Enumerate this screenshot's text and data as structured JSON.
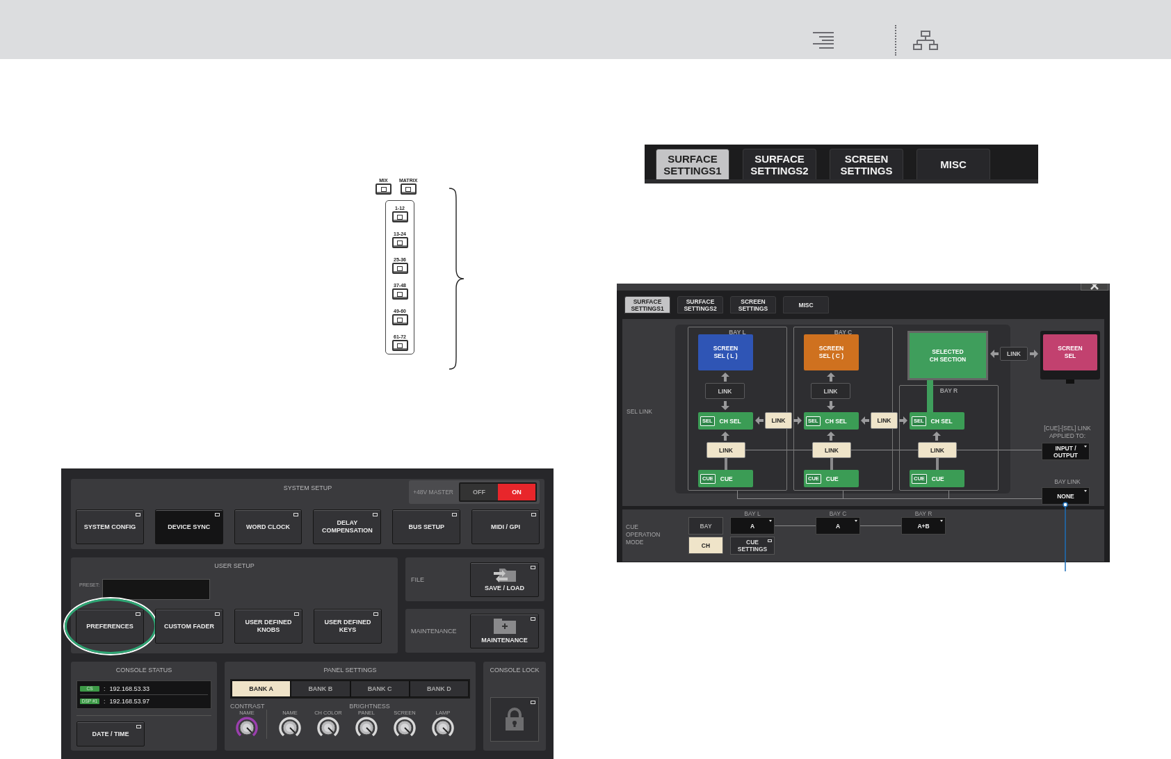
{
  "tab_strip": {
    "tabs": [
      {
        "label": "SURFACE\nSETTINGS1",
        "selected": true
      },
      {
        "label": "SURFACE\nSETTINGS2",
        "selected": false
      },
      {
        "label": "SCREEN\nSETTINGS",
        "selected": false
      },
      {
        "label": "MISC",
        "selected": false
      }
    ]
  },
  "bank_select_diagram": {
    "top_buttons": [
      "MIX",
      "MATRIX"
    ],
    "bank_buttons": [
      "1-12",
      "13-24",
      "25-36",
      "37-48",
      "49-60",
      "61-72"
    ]
  },
  "setup_screen": {
    "system_setup": {
      "title": "SYSTEM SETUP",
      "phantom": {
        "label": "+48V MASTER",
        "options": [
          {
            "label": "OFF",
            "selected": false
          },
          {
            "label": "ON",
            "selected": true
          }
        ]
      },
      "buttons": [
        {
          "label": "SYSTEM CONFIG",
          "selected": false
        },
        {
          "label": "DEVICE SYNC",
          "selected": true
        },
        {
          "label": "WORD CLOCK",
          "selected": false
        },
        {
          "label": "DELAY\nCOMPENSATION",
          "selected": false
        },
        {
          "label": "BUS SETUP",
          "selected": false
        },
        {
          "label": "MIDI / GPI",
          "selected": false
        }
      ]
    },
    "user_setup": {
      "title": "USER SETUP",
      "preset_label": "PRESET:",
      "buttons": [
        {
          "label": "PREFERENCES",
          "circled": true
        },
        {
          "label": "CUSTOM FADER",
          "circled": false
        },
        {
          "label": "USER DEFINED\nKNOBS",
          "circled": false
        },
        {
          "label": "USER DEFINED\nKEYS",
          "circled": false
        }
      ]
    },
    "file": {
      "label": "FILE",
      "button": "SAVE / LOAD"
    },
    "maintenance": {
      "label": "MAINTENANCE",
      "button": "MAINTENANCE"
    },
    "console_status": {
      "title": "CONSOLE STATUS",
      "entries": [
        {
          "tag": "CS",
          "separator": ":",
          "address": "192.168.53.33"
        },
        {
          "tag": "DSP #1",
          "separator": ":",
          "address": "192.168.53.97"
        }
      ],
      "button": "DATE / TIME"
    },
    "panel_settings": {
      "title": "PANEL SETTINGS",
      "banks": [
        {
          "label": "BANK A",
          "selected": true
        },
        {
          "label": "BANK B",
          "selected": false
        },
        {
          "label": "BANK C",
          "selected": false
        },
        {
          "label": "BANK D",
          "selected": false
        }
      ],
      "contrast_label": "CONTRAST",
      "brightness_label": "BRIGHTNESS",
      "knobs": [
        {
          "label": "NAME",
          "kind": "contrast"
        },
        {
          "label": "NAME",
          "kind": "brightness"
        },
        {
          "label": "CH COLOR",
          "kind": "brightness"
        },
        {
          "label": "PANEL",
          "kind": "brightness"
        },
        {
          "label": "SCREEN",
          "kind": "brightness"
        },
        {
          "label": "LAMP",
          "kind": "brightness"
        }
      ]
    },
    "console_lock": {
      "title": "CONSOLE LOCK"
    }
  },
  "preferences_window": {
    "tabs": [
      {
        "label": "SURFACE\nSETTINGS1",
        "selected": true
      },
      {
        "label": "SURFACE\nSETTINGS2",
        "selected": false
      },
      {
        "label": "SCREEN\nSETTINGS",
        "selected": false
      },
      {
        "label": "MISC",
        "selected": false
      }
    ],
    "sel_link": {
      "label": "SEL LINK",
      "bays": [
        {
          "kind": "screen",
          "title": "BAY L",
          "screen": "SCREEN\nSEL ( L )",
          "color": "#2f55b5",
          "screen_link": "LINK",
          "sel_tag": "SEL",
          "ch_sel": "CH SEL",
          "cue_link": "LINK",
          "cue_tag": "CUE",
          "cue": "CUE"
        },
        {
          "kind": "screen",
          "title": "BAY C",
          "screen": "SCREEN\nSEL ( C )",
          "color": "#cf711f",
          "screen_link": "LINK",
          "sel_tag": "SEL",
          "ch_sel": "CH SEL",
          "cue_link": "LINK",
          "cue_tag": "CUE",
          "cue": "CUE"
        },
        {
          "kind": "section",
          "title": "BAY R",
          "sel_tag": "SEL",
          "ch_sel": "CH SEL",
          "cue_link": "LINK",
          "cue_tag": "CUE",
          "cue": "CUE"
        }
      ],
      "bay_links": [
        "LINK",
        "LINK"
      ],
      "section": {
        "label": "SELECTED\nCH SECTION",
        "link": "LINK",
        "screen_sel": "SCREEN\nSEL"
      },
      "cue_sel_link": {
        "label": "[CUE]-[SEL] LINK\nAPPLIED TO:",
        "value": "INPUT /\nOUTPUT"
      },
      "bay_link": {
        "label": "BAY LINK",
        "value": "NONE"
      }
    },
    "cue_operation": {
      "label": "CUE\nOPERATION\nMODE",
      "modes": [
        {
          "label": "BAY",
          "selected": false
        },
        {
          "label": "CH",
          "selected": true
        }
      ],
      "bays": [
        {
          "title": "BAY L",
          "value": "A"
        },
        {
          "title": "BAY C",
          "value": "A"
        },
        {
          "title": "BAY R",
          "value": "A+B"
        }
      ],
      "settings_button": "CUE\nSETTINGS"
    }
  }
}
